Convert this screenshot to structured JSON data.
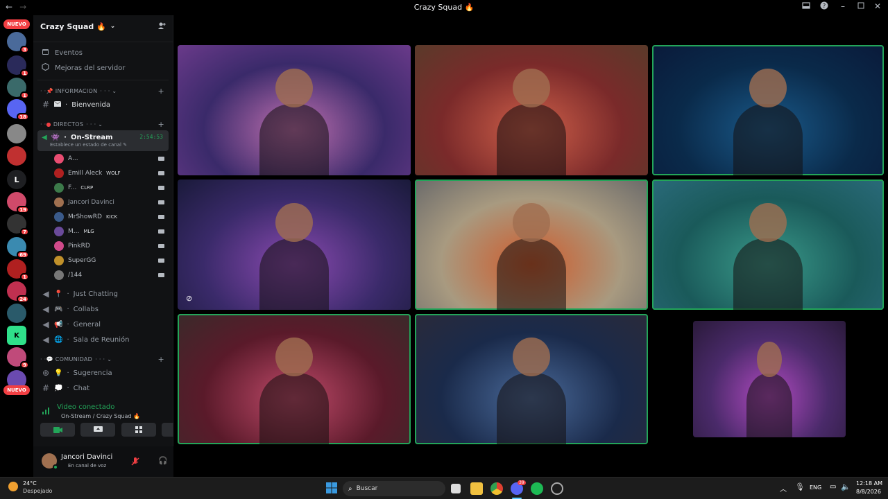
{
  "window": {
    "title": "Crazy Squad 🔥",
    "nav_back": "←",
    "nav_forward": "→"
  },
  "guilds": {
    "nuevo_top": "NUEVO",
    "nuevo_bottom": "NUEVO",
    "items": [
      {
        "badge": "3"
      },
      {
        "badge": "1"
      },
      {
        "badge": "1"
      },
      {
        "badge": "18"
      },
      {
        "badge": ""
      },
      {
        "badge": ""
      },
      {
        "label": "L",
        "badge": ""
      },
      {
        "badge": "19"
      },
      {
        "badge": "7"
      },
      {
        "badge": "69"
      },
      {
        "badge": "1"
      },
      {
        "badge": "24"
      },
      {
        "badge": ""
      },
      {
        "badge": ""
      },
      {
        "badge": "9"
      },
      {
        "badge": ""
      }
    ]
  },
  "server": {
    "name": "Crazy Squad 🔥",
    "events": "Eventos",
    "boosts": "Mejoras del servidor",
    "categories": {
      "info": "INFORMACION",
      "directos": "DIRECTOS",
      "comunidad": "COMUNIDAD"
    },
    "channels": {
      "bienvenida": "Bienvenida",
      "on_stream": "On-Stream",
      "on_stream_status": "Establece un estado de canal",
      "on_stream_timer": "2:54:53",
      "just_chatting": "Just Chatting",
      "collabs": "Collabs",
      "general": "General",
      "sala": "Sala de Reunión",
      "sugerencia": "Sugerencia",
      "chat": "Chat"
    },
    "members": [
      {
        "name": "A...",
        "tag": "",
        "color": "#e94d72"
      },
      {
        "name": "Emill Aleck",
        "tag": "WOLF",
        "color": "#b02020"
      },
      {
        "name": "F...",
        "tag": "CLRP",
        "color": "#3c7a4a"
      },
      {
        "name": "Jancori Davinci",
        "tag": "",
        "color": "#a07050"
      },
      {
        "name": "MrShowRD",
        "tag": "KICK",
        "color": "#3a5a8a"
      },
      {
        "name": "M...",
        "tag": "MLG",
        "color": "#6a4a9a"
      },
      {
        "name": "PinkRD",
        "tag": "",
        "color": "#d04a8a"
      },
      {
        "name": "SuperGG",
        "tag": "",
        "color": "#c0902a"
      },
      {
        "name": "/144",
        "tag": "",
        "color": "#777777"
      }
    ]
  },
  "voice": {
    "status": "Video conectado",
    "location": "On-Stream / Crazy Squad 🔥"
  },
  "user": {
    "name": "Jancori Davinci",
    "status": "En canal de voz"
  },
  "video_tiles": [
    {
      "name": "tile-1",
      "colors": [
        "#3a2a6a",
        "#c070b0",
        "#6a3a8a"
      ],
      "speaking": false
    },
    {
      "name": "tile-2",
      "colors": [
        "#7a2a2a",
        "#d0604a",
        "#5a3a2a"
      ],
      "speaking": false
    },
    {
      "name": "tile-3",
      "colors": [
        "#0a2a4a",
        "#1a5a8a",
        "#0a1a3a"
      ],
      "speaking": true
    },
    {
      "name": "tile-4",
      "colors": [
        "#3a2a6a",
        "#8a4ab0",
        "#1a1a3a"
      ],
      "speaking": false
    },
    {
      "name": "tile-5",
      "colors": [
        "#a89a80",
        "#d05a2a",
        "#6a6a6a"
      ],
      "speaking": true
    },
    {
      "name": "tile-6",
      "colors": [
        "#1a5a5a",
        "#3a9a8a",
        "#2a6a7a"
      ],
      "speaking": true
    },
    {
      "name": "tile-7",
      "colors": [
        "#5a1a2a",
        "#c04a6a",
        "#3a2a2a"
      ],
      "speaking": true
    },
    {
      "name": "tile-8",
      "colors": [
        "#1a2a4a",
        "#4a6a9a",
        "#2a2a3a"
      ],
      "speaking": true
    },
    {
      "name": "tile-9",
      "colors": [
        "#4a2a6a",
        "#b04ac0",
        "#2a1a3a"
      ],
      "speaking": false
    }
  ],
  "taskbar": {
    "temp": "24°C",
    "weather": "Despejado",
    "search": "Buscar",
    "lang": "ENG",
    "time": "12:18 AM",
    "date": "8/8/2026",
    "discord_badge": "39"
  }
}
